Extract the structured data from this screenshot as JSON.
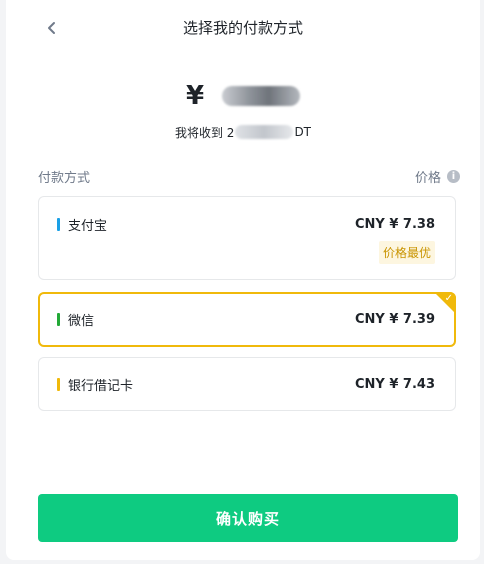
{
  "header": {
    "title": "选择我的付款方式",
    "back_icon": "chevron-left-icon"
  },
  "order": {
    "currency_symbol": "¥",
    "receive_prefix": "我将收到 2",
    "receive_suffix": "DT"
  },
  "section": {
    "method_label": "付款方式",
    "price_label": "价格",
    "info_icon": "info-icon"
  },
  "methods": [
    {
      "name": "支付宝",
      "price": "CNY ¥ 7.38",
      "badge": "价格最优",
      "color": "#1aa0e6",
      "selected": false
    },
    {
      "name": "微信",
      "price": "CNY ¥ 7.39",
      "color": "#23a937",
      "selected": true
    },
    {
      "name": "银行借记卡",
      "price": "CNY ¥ 7.43",
      "color": "#f0b90b",
      "selected": false
    }
  ],
  "colors": {
    "accent": "#f0b90b",
    "confirm": "#0ecb81"
  },
  "confirm_button": {
    "label": "确认购买"
  }
}
